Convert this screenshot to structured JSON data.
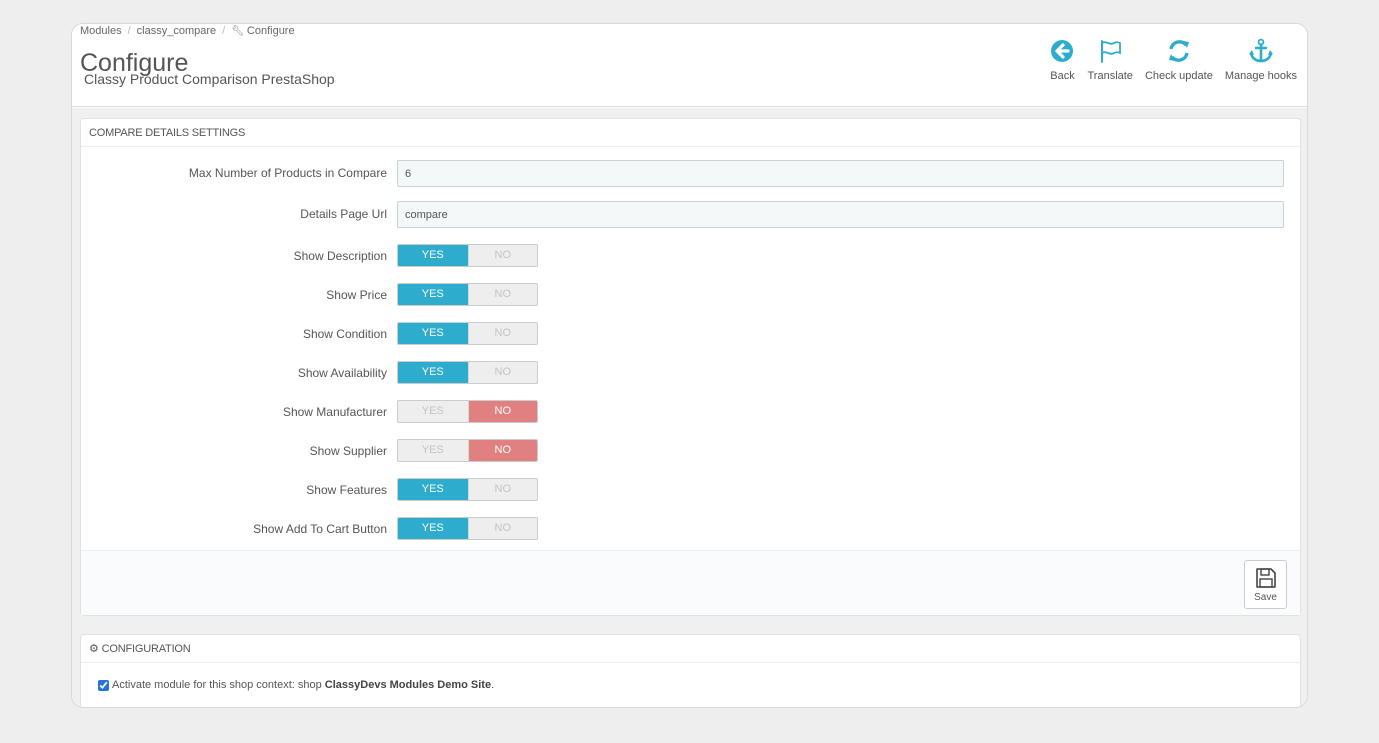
{
  "breadcrumb": {
    "items": [
      "Modules",
      "classy_compare",
      "Configure"
    ]
  },
  "header": {
    "title": "Configure",
    "subtitle": "Classy Product Comparison PrestaShop"
  },
  "toolbar": {
    "back": "Back",
    "translate": "Translate",
    "check_update": "Check update",
    "manage_hooks": "Manage hooks"
  },
  "settings_panel": {
    "heading": "COMPARE DETAILS SETTINGS",
    "max_products": {
      "label": "Max Number of Products in Compare",
      "value": "6"
    },
    "details_url": {
      "label": "Details Page Url",
      "value": "compare"
    },
    "switch_yes": "YES",
    "switch_no": "NO",
    "toggles": [
      {
        "label": "Show Description",
        "value": "YES"
      },
      {
        "label": "Show Price",
        "value": "YES"
      },
      {
        "label": "Show Condition",
        "value": "YES"
      },
      {
        "label": "Show Availability",
        "value": "YES"
      },
      {
        "label": "Show Manufacturer",
        "value": "NO"
      },
      {
        "label": "Show Supplier",
        "value": "NO"
      },
      {
        "label": "Show Features",
        "value": "YES"
      },
      {
        "label": "Show Add To Cart Button",
        "value": "YES"
      }
    ],
    "save_label": "Save"
  },
  "config_panel": {
    "heading": "CONFIGURATION",
    "activate_text": "Activate module for this shop context: shop ",
    "shop_name": "ClassyDevs Modules Demo Site",
    "activate_suffix": ".",
    "checked": true
  },
  "colors": {
    "accent": "#2eacce",
    "no_active": "#e08080"
  }
}
